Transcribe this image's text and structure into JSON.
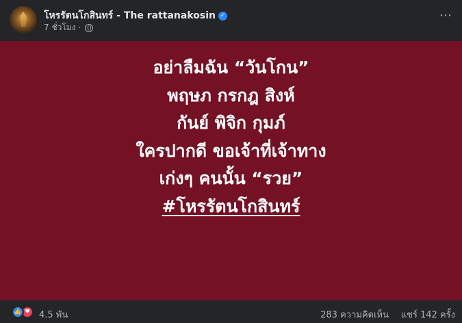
{
  "header": {
    "page_name": "โหรรัตนโกสินทร์ - The rattanakosin",
    "time": "7 ชั่วโมง",
    "separator": "·"
  },
  "icons": {
    "verified": "verified-badge-icon",
    "privacy": "globe-icon",
    "more": "more-options-icon",
    "like": "like-reaction-icon",
    "love": "love-reaction-icon"
  },
  "colors": {
    "background": "#242526",
    "image_background": "#741124",
    "text_primary": "#e4e6eb",
    "text_secondary": "#b0b3b8",
    "like_blue": "#2d88ff",
    "love_red": "#f33e58"
  },
  "post_image": {
    "lines": [
      "อย่าลืมฉัน “วันโกน”",
      "พฤษภ กรกฎ สิงห์",
      "กันย์ พิจิก กุมภ์",
      "ใครปากดี ขอเจ้าที่เจ้าทาง",
      "เก่งๆ คนนั้น “รวย”"
    ],
    "hashtag": "#โหรรัตนโกสินทร์"
  },
  "footer": {
    "reaction_count": "4.5 พัน",
    "comments": "283 ความคิดเห็น",
    "shares": "แชร์ 142 ครั้ง"
  }
}
